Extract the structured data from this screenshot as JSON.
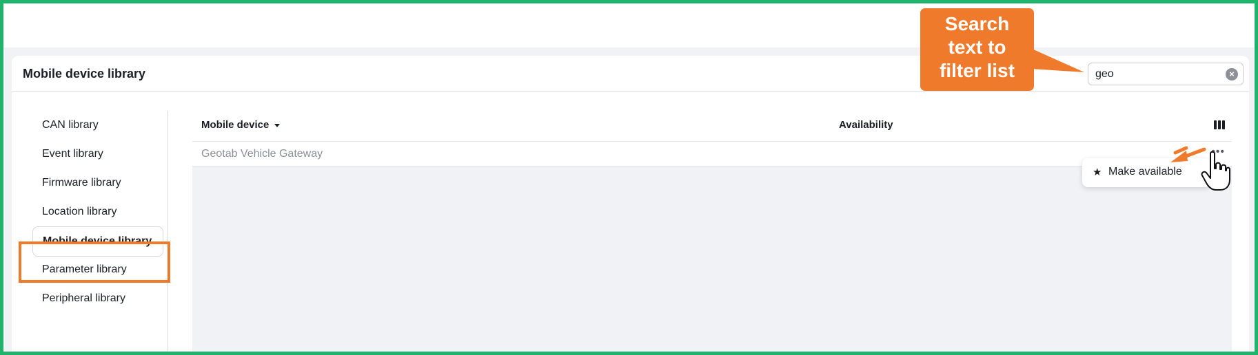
{
  "panel": {
    "title": "Mobile device library",
    "search": {
      "value": "geo",
      "clear_icon": "clear-icon"
    }
  },
  "sidebar": {
    "items": [
      {
        "label": "CAN library"
      },
      {
        "label": "Event library"
      },
      {
        "label": "Firmware library"
      },
      {
        "label": "Location library"
      },
      {
        "label": "Mobile device library",
        "active": true
      },
      {
        "label": "Parameter library"
      },
      {
        "label": "Peripheral library"
      }
    ]
  },
  "table": {
    "columns": [
      "Mobile device",
      "Availability"
    ],
    "rows": [
      {
        "device": "Geotab Vehicle Gateway",
        "availability": ""
      }
    ],
    "columns_icon": "columns-icon",
    "more_icon": "more-icon"
  },
  "row_menu": {
    "items": [
      {
        "icon": "star-icon",
        "label": "Make available"
      }
    ]
  },
  "annotations": {
    "callout_text": "Search text to filter list",
    "callout_lines": [
      "Search",
      "text to",
      "filter list"
    ],
    "accent_color": "#f07a2b",
    "frame_color": "#1fb36b"
  }
}
